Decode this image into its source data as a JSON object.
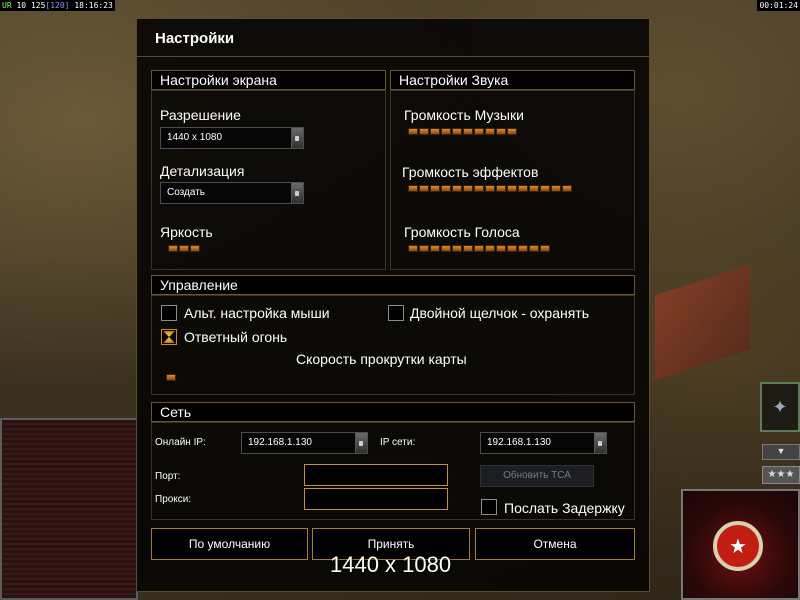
{
  "hud": {
    "left_prefix": "UR",
    "left_a": "10",
    "left_b": "125",
    "left_c": "[120]",
    "left_time": "18:16:23",
    "right_time": "00:01:24"
  },
  "dialog": {
    "title": "Настройки"
  },
  "display": {
    "section": "Настройки экрана",
    "resolution_label": "Разрешение",
    "resolution_value": "1440 x 1080",
    "detail_label": "Детализация",
    "detail_value": "Создать",
    "brightness_label": "Яркость",
    "brightness_segments": 3
  },
  "sound": {
    "section": "Настройки Звука",
    "music_label": "Громкость Музыки",
    "music_segments": 10,
    "effects_label": "Громкость эффектов",
    "effects_segments": 15,
    "voice_label": "Громкость Голоса",
    "voice_segments": 13
  },
  "controls": {
    "section": "Управление",
    "alt_mouse_label": "Альт. настройка мыши",
    "alt_mouse_checked": false,
    "double_click_label": "Двойной щелчок - охранять",
    "double_click_checked": false,
    "return_fire_label": "Ответный огонь",
    "return_fire_checked": true,
    "scroll_speed_label": "Скорость прокрутки карты",
    "scroll_speed_segments": 1
  },
  "network": {
    "section": "Сеть",
    "online_ip_label": "Онлайн IP:",
    "online_ip_value": "192.168.1.130",
    "lan_ip_label": "IP сети:",
    "lan_ip_value": "192.168.1.130",
    "port_label": "Порт:",
    "port_value": "",
    "proxy_label": "Прокси:",
    "proxy_value": "",
    "update_tca_label": "Обновить ТСА",
    "send_delay_label": "Послать Задержку",
    "send_delay_checked": false
  },
  "buttons": {
    "defaults": "По умолчанию",
    "accept": "Принять",
    "cancel": "Отмена"
  },
  "footer": {
    "resolution_caption": "1440 x 1080"
  },
  "colors": {
    "accent_orange": "#e08a2a",
    "border_gold": "#a57a3a",
    "dialog_bg": "#080604"
  }
}
